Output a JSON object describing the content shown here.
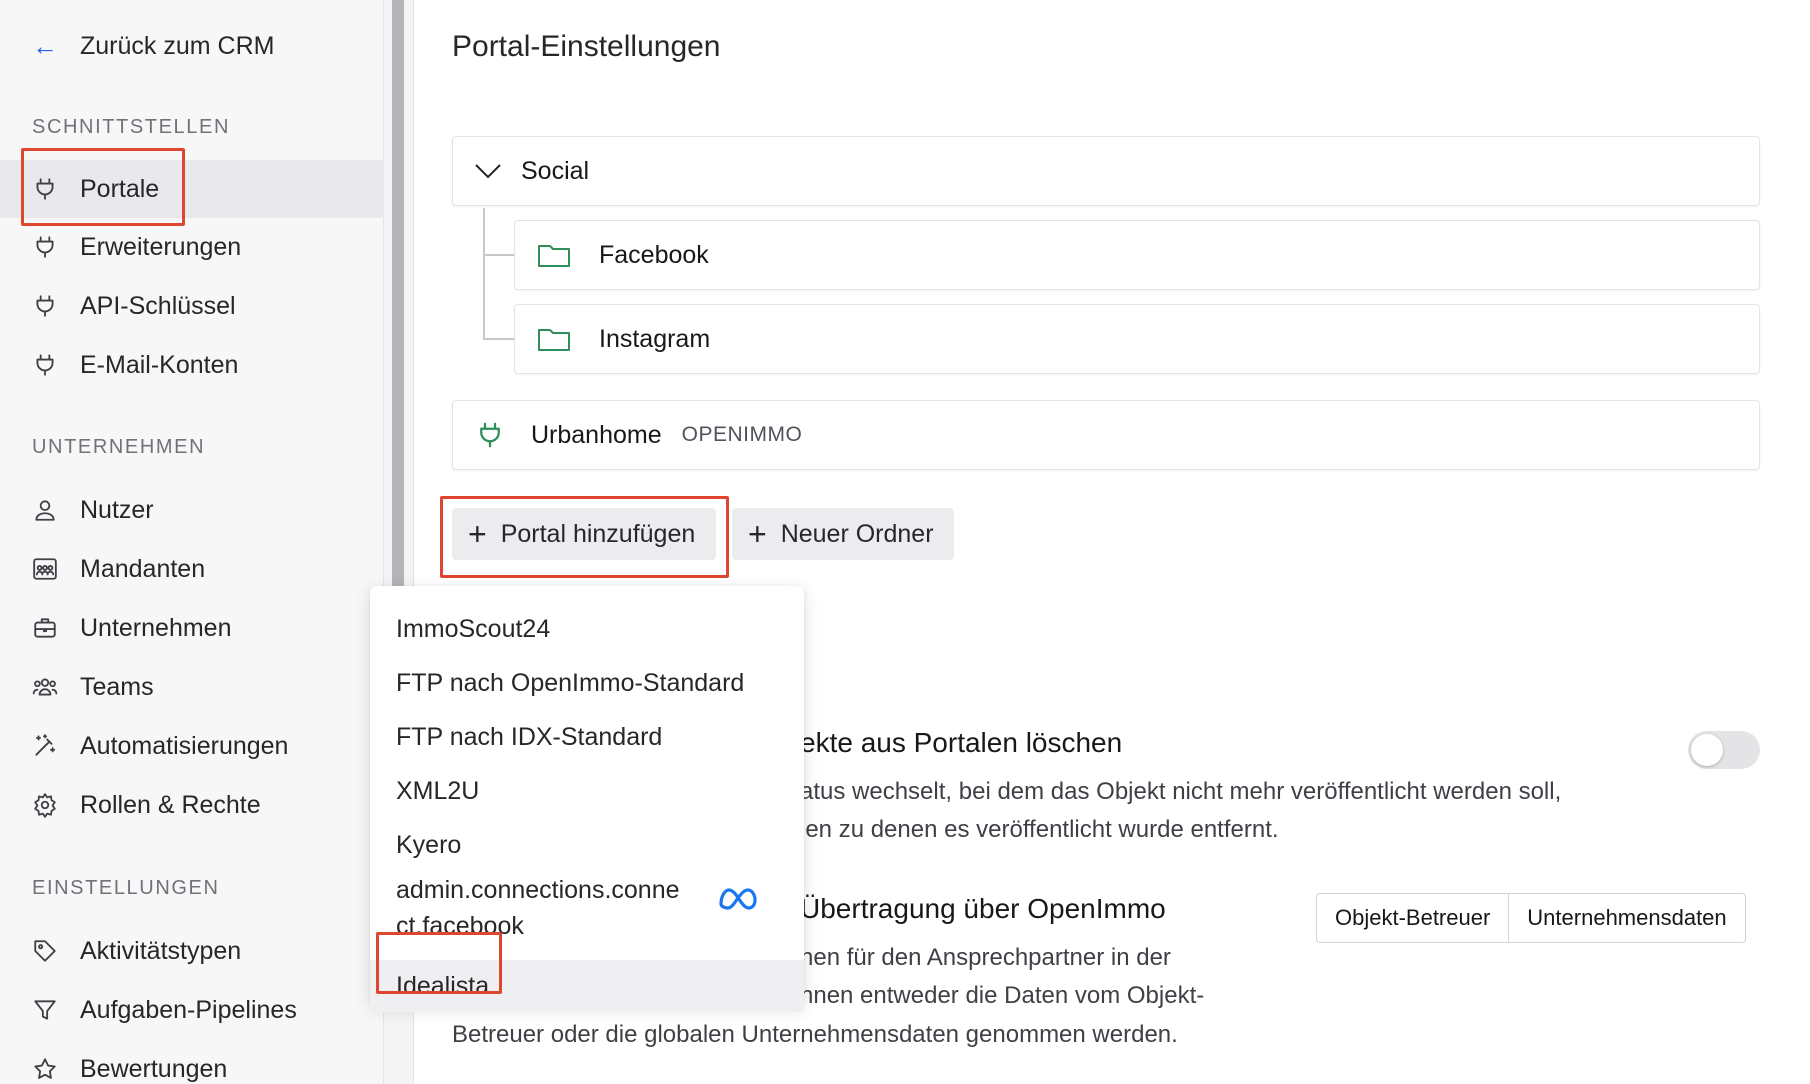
{
  "sidebar": {
    "back_label": "Zurück zum CRM",
    "sections": {
      "schnittstellen": "SCHNITTSTELLEN",
      "unternehmen": "UNTERNEHMEN",
      "einstellungen": "EINSTELLUNGEN"
    },
    "items": {
      "portale": "Portale",
      "erweiterungen": "Erweiterungen",
      "api": "API-Schlüssel",
      "email": "E-Mail-Konten",
      "nutzer": "Nutzer",
      "mandanten": "Mandanten",
      "unternehmen": "Unternehmen",
      "teams": "Teams",
      "automatisierungen": "Automatisierungen",
      "rollen": "Rollen & Rechte",
      "aktivitaet": "Aktivitätstypen",
      "pipelines": "Aufgaben-Pipelines",
      "bewertungen": "Bewertungen"
    }
  },
  "main": {
    "title": "Portal-Einstellungen",
    "tree": {
      "social": "Social",
      "facebook": "Facebook",
      "instagram": "Instagram",
      "urbanhome": "Urbanhome",
      "urbanhome_tag": "OPENIMMO"
    },
    "buttons": {
      "add_portal": "Portal hinzufügen",
      "new_folder": "Neuer Ordner"
    },
    "delete_setting": {
      "heading": "ekte aus Portalen löschen",
      "line1": "atus wechselt, bei dem das Objekt nicht mehr veröffentlicht werden soll,",
      "line2": "len zu denen es veröffentlicht wurde entfernt.",
      "enabled": false
    },
    "transfer_setting": {
      "heading": "Übertragung über OpenImmo",
      "line1": "nen für den Ansprechpartner in der",
      "line2": "nnen entweder die Daten vom Objekt-",
      "line3": "Betreuer oder die globalen Unternehmensdaten genommen werden.",
      "options": [
        "Objekt-Betreuer",
        "Unternehmensdaten"
      ]
    }
  },
  "dropdown": {
    "items": [
      "ImmoScout24",
      "FTP nach OpenImmo-Standard",
      "FTP nach IDX-Standard",
      "XML2U",
      "Kyero",
      "admin.connections.conne",
      "ct.facebook",
      "Idealista"
    ]
  },
  "colors": {
    "accent_blue": "#2563eb",
    "highlight_red": "#e0452f",
    "folder_green": "#2f8f5b"
  }
}
